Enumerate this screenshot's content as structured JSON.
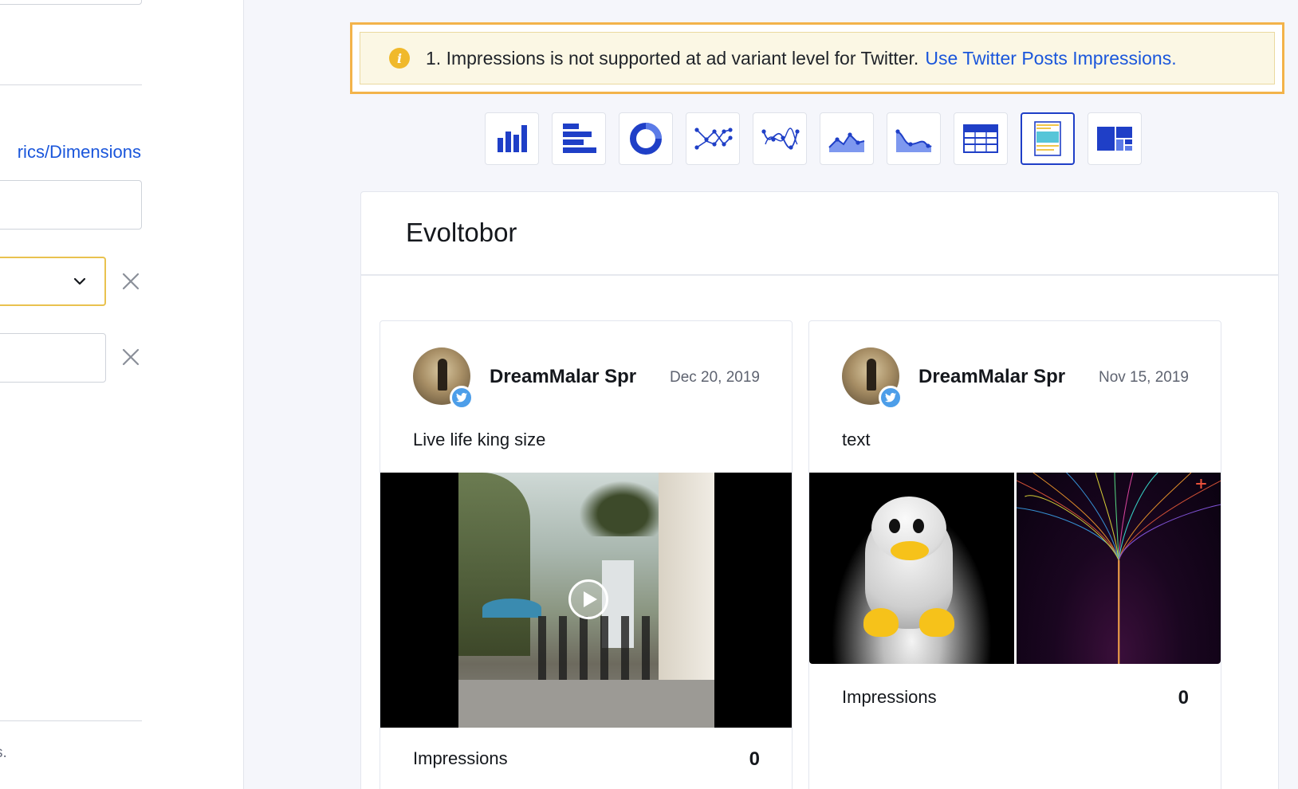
{
  "left_panel": {
    "link_label": "rics/Dimensions",
    "footer_text": "s."
  },
  "banner": {
    "message": "1. Impressions is not supported at ad variant level for Twitter.",
    "link": "Use Twitter Posts Impressions.",
    "icon_glyph": "i",
    "accent_color": "#f3b34a"
  },
  "toolbar": {
    "active": "post-view",
    "items": [
      "bar-chart",
      "horizontal-bar-chart",
      "donut-chart",
      "scatter-line-chart",
      "curved-line-chart",
      "area-chart",
      "smooth-area-chart",
      "table",
      "post-view",
      "treemap"
    ]
  },
  "card": {
    "title": "Evoltobor"
  },
  "posts": [
    {
      "author": "DreamMalar Spr",
      "date": "Dec 20, 2019",
      "text": "Live life king size",
      "media": "video",
      "metric_label": "Impressions",
      "metric_value": "0"
    },
    {
      "author": "DreamMalar Spr",
      "date": "Nov 15, 2019",
      "text": "text",
      "media": "images",
      "metric_label": "Impressions",
      "metric_value": "0"
    }
  ],
  "colors": {
    "accent_blue": "#1a56db",
    "icon_blue": "#1f3fc7",
    "twitter_blue": "#4d9ee9"
  }
}
